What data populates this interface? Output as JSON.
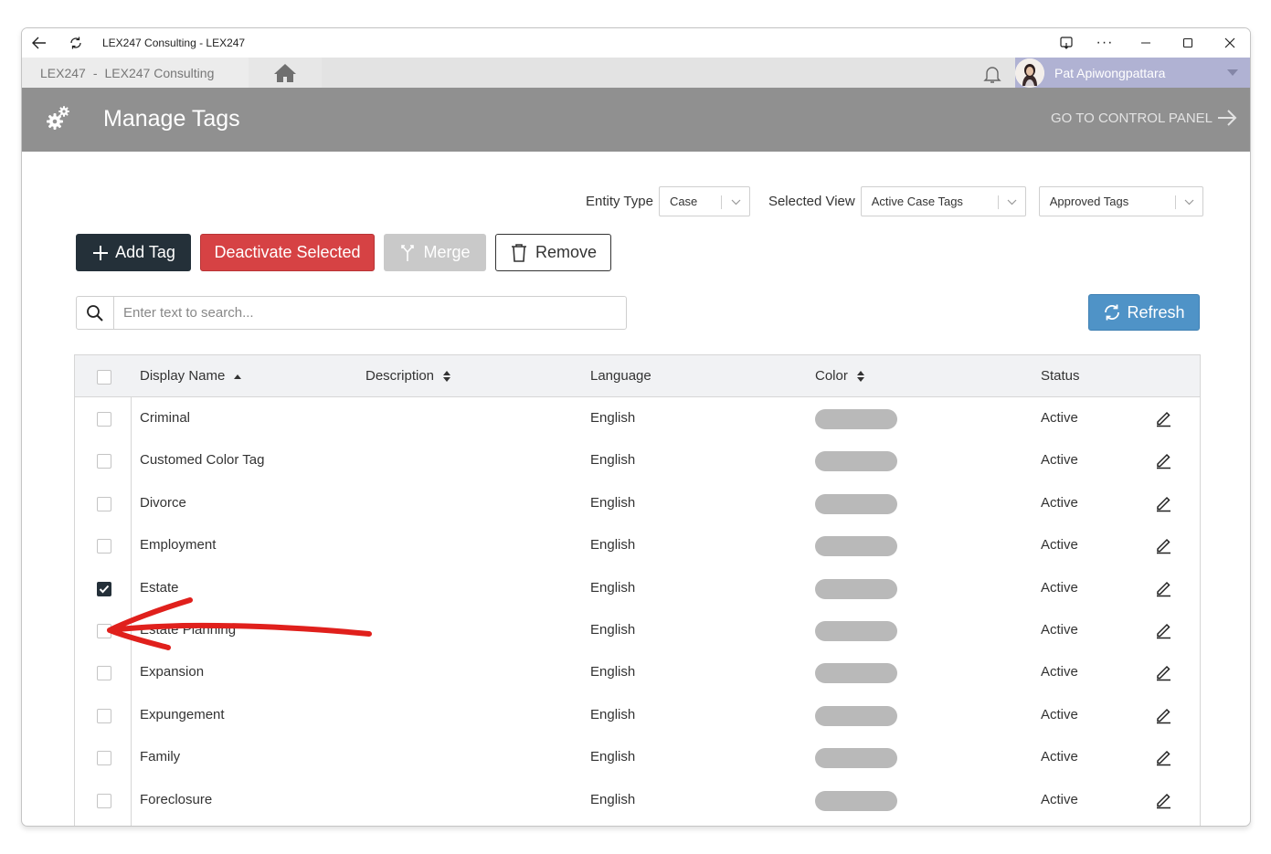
{
  "window": {
    "title": "LEX247 Consulting - LEX247"
  },
  "nav": {
    "breadcrumb_root": "LEX247",
    "breadcrumb_sep": "-",
    "breadcrumb_firm": "LEX247 Consulting",
    "user_name": "Pat Apiwongpattara"
  },
  "header": {
    "title": "Manage Tags",
    "control_panel_link": "GO TO CONTROL PANEL"
  },
  "filters": {
    "entity_type_label": "Entity Type",
    "entity_type_value": "Case",
    "selected_view_label": "Selected View",
    "selected_view_value": "Active Case Tags",
    "approval_value": "Approved Tags"
  },
  "toolbar": {
    "add_label": "Add Tag",
    "deactivate_label": "Deactivate Selected",
    "merge_label": "Merge",
    "remove_label": "Remove",
    "refresh_label": "Refresh"
  },
  "search": {
    "placeholder": "Enter text to search..."
  },
  "grid": {
    "columns": {
      "display_name": "Display Name",
      "description": "Description",
      "language": "Language",
      "color": "Color",
      "status": "Status"
    },
    "rows": [
      {
        "name": "Criminal",
        "description": "",
        "language": "English",
        "color": "#b9b9b9",
        "status": "Active",
        "checked": false
      },
      {
        "name": "Customed Color Tag",
        "description": "",
        "language": "English",
        "color": "#b9b9b9",
        "status": "Active",
        "checked": false
      },
      {
        "name": "Divorce",
        "description": "",
        "language": "English",
        "color": "#b9b9b9",
        "status": "Active",
        "checked": false
      },
      {
        "name": "Employment",
        "description": "",
        "language": "English",
        "color": "#b9b9b9",
        "status": "Active",
        "checked": false
      },
      {
        "name": "Estate",
        "description": "",
        "language": "English",
        "color": "#b9b9b9",
        "status": "Active",
        "checked": true
      },
      {
        "name": "Estate Planning",
        "description": "",
        "language": "English",
        "color": "#b9b9b9",
        "status": "Active",
        "checked": false
      },
      {
        "name": "Expansion",
        "description": "",
        "language": "English",
        "color": "#b9b9b9",
        "status": "Active",
        "checked": false
      },
      {
        "name": "Expungement",
        "description": "",
        "language": "English",
        "color": "#b9b9b9",
        "status": "Active",
        "checked": false
      },
      {
        "name": "Family",
        "description": "",
        "language": "English",
        "color": "#b9b9b9",
        "status": "Active",
        "checked": false
      },
      {
        "name": "Foreclosure",
        "description": "",
        "language": "English",
        "color": "#b9b9b9",
        "status": "Active",
        "checked": false
      }
    ]
  },
  "colors": {
    "header_bg": "#909090",
    "primary_dark": "#243039",
    "danger": "#d64244",
    "info": "#4f93c7",
    "user_bg": "#b0b2d3",
    "annotation": "#e0201c"
  },
  "icons": [
    "back-arrow-icon",
    "reload-icon",
    "cast-icon",
    "more-icon",
    "minimize-icon",
    "maximize-icon",
    "close-icon",
    "home-icon",
    "bell-icon",
    "gears-icon",
    "arrow-right-icon",
    "chevron-down-icon",
    "plus-icon",
    "merge-icon",
    "trash-icon",
    "search-icon",
    "refresh-icon",
    "sort-asc-icon",
    "sort-both-icon",
    "edit-icon"
  ]
}
